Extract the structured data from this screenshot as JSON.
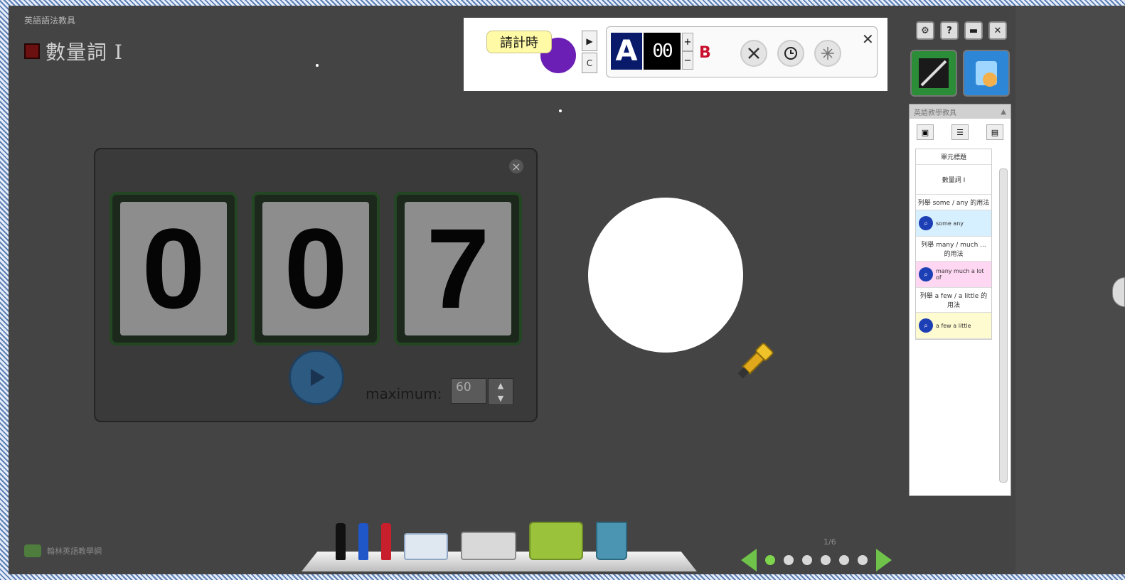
{
  "app": {
    "subtitle": "英語語法教具",
    "title": "數量詞 I",
    "brand": "翰林英語教學網"
  },
  "topbar": {
    "tooltip": "請計時",
    "play_symbol": "▶",
    "clear_symbol": "C",
    "letter_a": "A",
    "number_display": "00",
    "plus": "+",
    "minus": "−",
    "letter_b": "B",
    "close": "✕",
    "tool_icons": [
      "tools-icon",
      "clock-icon",
      "sparkle-icon"
    ]
  },
  "window_controls": {
    "settings": "⚙",
    "help": "?",
    "minimize": "▬",
    "close": "✕"
  },
  "side_panel": {
    "header": "英語教學教具",
    "collapse": "▲",
    "items": [
      {
        "label": "單元標題"
      },
      {
        "label": "數量詞 I"
      },
      {
        "label": "列舉 some / any 的用法"
      },
      {
        "label": "some any",
        "card": true,
        "color": "#d7f0ff"
      },
      {
        "label": "列舉 many / much ... 的用法"
      },
      {
        "label": "many much a lot of",
        "card": true,
        "color": "#ffd7f2"
      },
      {
        "label": "列舉 a few / a little 的用法"
      },
      {
        "label": "a few a little",
        "card": true,
        "color": "#fffbd0"
      }
    ]
  },
  "counter": {
    "digits": [
      "0",
      "0",
      "7"
    ],
    "max_label": "maximum:",
    "max_value": "60",
    "close": "×"
  },
  "pager": {
    "page_label": "1/6",
    "total_dots": 6,
    "active_index": 0
  },
  "colors": {
    "workspace": "#444444",
    "accent_green": "#6fc34a",
    "pen_black": "#111111",
    "pen_blue": "#1f56c8",
    "pen_red": "#c81f2d"
  }
}
